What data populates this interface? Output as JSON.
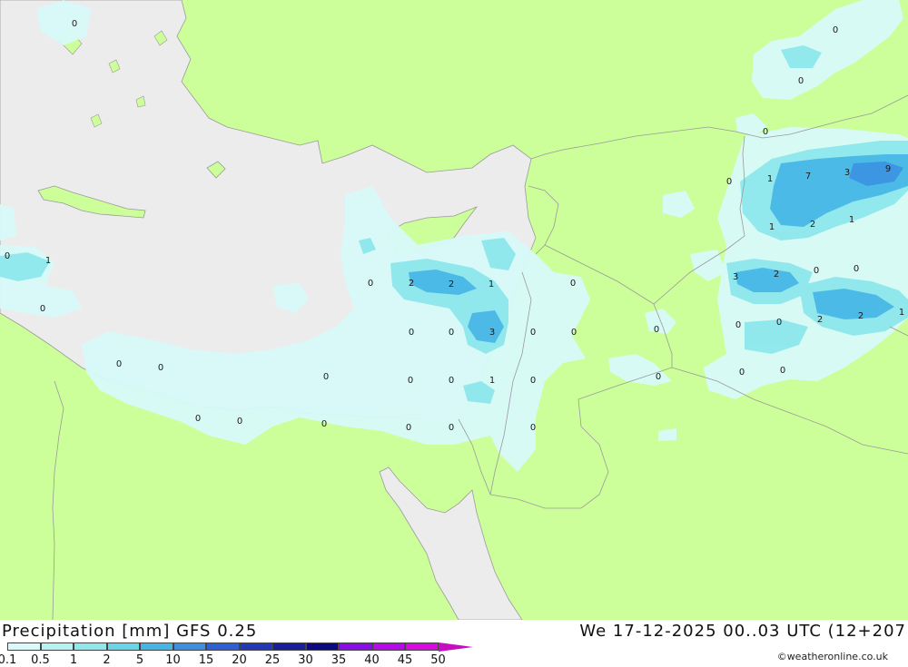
{
  "title": "Precipitation [mm]  GFS 0.25",
  "datetime": "We 17-12-2025 00..03 UTC (12+207",
  "credit": "©weatheronline.co.uk",
  "legend": {
    "labels": [
      "0.1",
      "0.5",
      "1",
      "2",
      "5",
      "10",
      "15",
      "20",
      "25",
      "30",
      "35",
      "40",
      "45",
      "50"
    ],
    "colors": [
      "#d8fafa",
      "#b5f3f3",
      "#8ee8ec",
      "#66d6e8",
      "#45b5e6",
      "#3a8fe0",
      "#2f5fd5",
      "#2238b8",
      "#18209c",
      "#0b0a84",
      "#8a0ce6",
      "#b70ae9",
      "#d90ae0",
      "#c40fc0"
    ]
  },
  "colors": {
    "land": "#ccff99",
    "sea": "#ececec",
    "border": "#9a9a9a",
    "light_rain": "#d8fafa",
    "medium_rain": "#8ee8ec",
    "heavier_rain": "#45b5e6"
  },
  "values": [
    {
      "text": "0"
    },
    {
      "text": "0"
    },
    {
      "text": "0"
    },
    {
      "text": "0"
    },
    {
      "text": "1"
    },
    {
      "text": "7"
    },
    {
      "text": "3"
    },
    {
      "text": "9"
    },
    {
      "text": "1"
    },
    {
      "text": "2"
    },
    {
      "text": "1"
    },
    {
      "text": "0"
    },
    {
      "text": "1"
    },
    {
      "text": "0"
    },
    {
      "text": "0"
    },
    {
      "text": "2"
    },
    {
      "text": "2"
    },
    {
      "text": "1"
    },
    {
      "text": "0"
    },
    {
      "text": "3"
    },
    {
      "text": "2"
    },
    {
      "text": "0"
    },
    {
      "text": "0"
    },
    {
      "text": "0"
    },
    {
      "text": "0"
    },
    {
      "text": "3"
    },
    {
      "text": "0"
    },
    {
      "text": "0"
    },
    {
      "text": "0"
    },
    {
      "text": "0"
    },
    {
      "text": "0"
    },
    {
      "text": "2"
    },
    {
      "text": "2"
    },
    {
      "text": "1"
    },
    {
      "text": "0"
    },
    {
      "text": "0"
    },
    {
      "text": "0"
    },
    {
      "text": "0"
    },
    {
      "text": "0"
    },
    {
      "text": "1"
    },
    {
      "text": "0"
    },
    {
      "text": "0"
    },
    {
      "text": "0"
    },
    {
      "text": "0"
    },
    {
      "text": "0"
    },
    {
      "text": "0"
    },
    {
      "text": "0"
    },
    {
      "text": "0"
    },
    {
      "text": "0"
    },
    {
      "text": "0"
    },
    {
      "text": "0"
    }
  ]
}
